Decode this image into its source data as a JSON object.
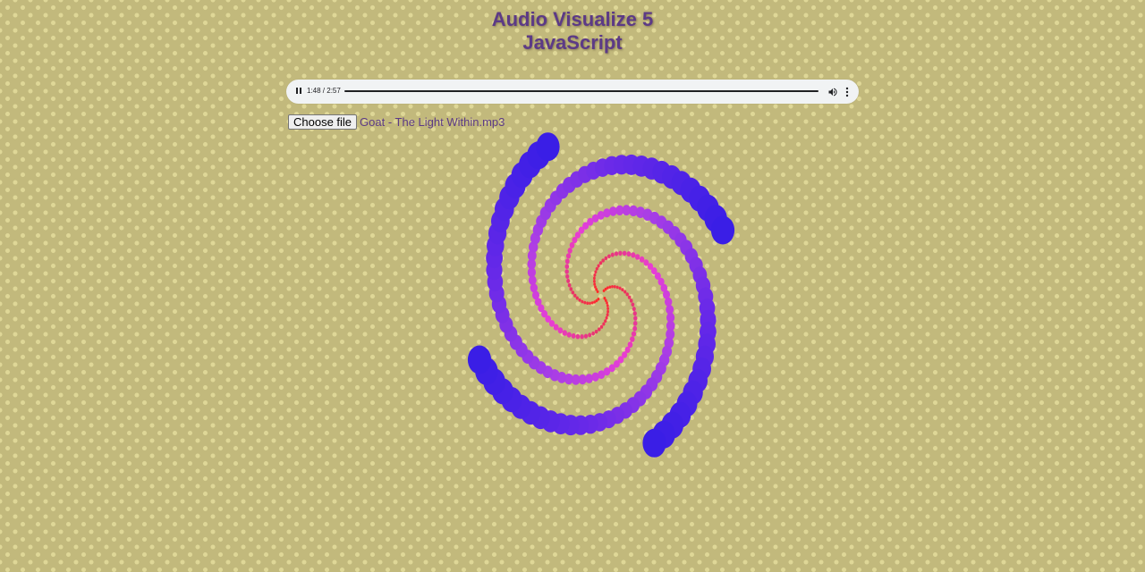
{
  "header": {
    "title_line1": "Audio Visualize 5",
    "title_line2": "JavaScript"
  },
  "player": {
    "state": "playing",
    "time": "1:48 / 2:57",
    "progress_fraction": 0.61,
    "play_pause_icon": "pause-icon",
    "volume_icon": "volume-icon",
    "menu_icon": "more-vert-icon"
  },
  "file_input": {
    "button_label": "Choose file",
    "file_name": "Goat - The Light Within.mp3"
  },
  "colors": {
    "title": "#5c3a86",
    "background": "#c2b97c",
    "dots": "#e6e0a0",
    "visualizer_palette": [
      "#ff2a2a",
      "#e8356a",
      "#e83ed6",
      "#a83ee6",
      "#6a2ae8",
      "#3a1ee6"
    ]
  }
}
